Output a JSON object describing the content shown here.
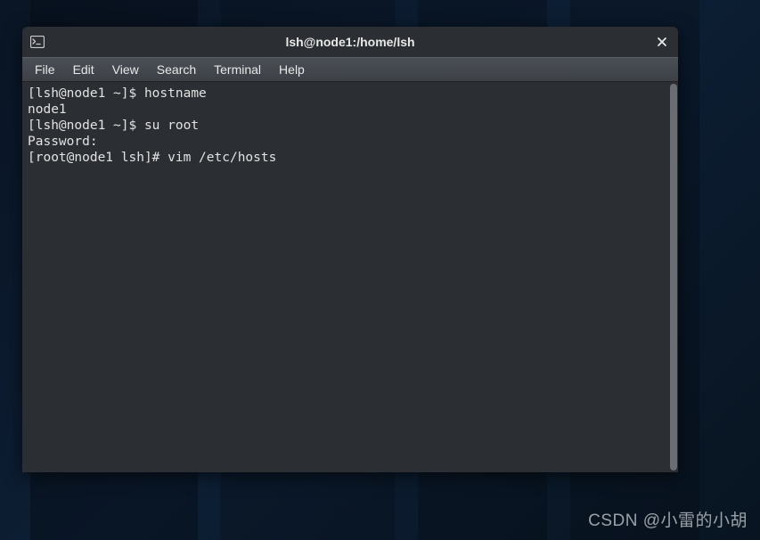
{
  "window": {
    "title": "lsh@node1:/home/lsh"
  },
  "menubar": {
    "items": [
      {
        "label": "File"
      },
      {
        "label": "Edit"
      },
      {
        "label": "View"
      },
      {
        "label": "Search"
      },
      {
        "label": "Terminal"
      },
      {
        "label": "Help"
      }
    ]
  },
  "terminal": {
    "lines": [
      {
        "text": "[lsh@node1 ~]$ hostname"
      },
      {
        "text": "node1"
      },
      {
        "text": "[lsh@node1 ~]$ su root"
      },
      {
        "text": "Password: "
      },
      {
        "text": "[root@node1 lsh]# vim /etc/hosts"
      }
    ]
  },
  "watermark": {
    "text": "CSDN @小雷的小胡"
  }
}
